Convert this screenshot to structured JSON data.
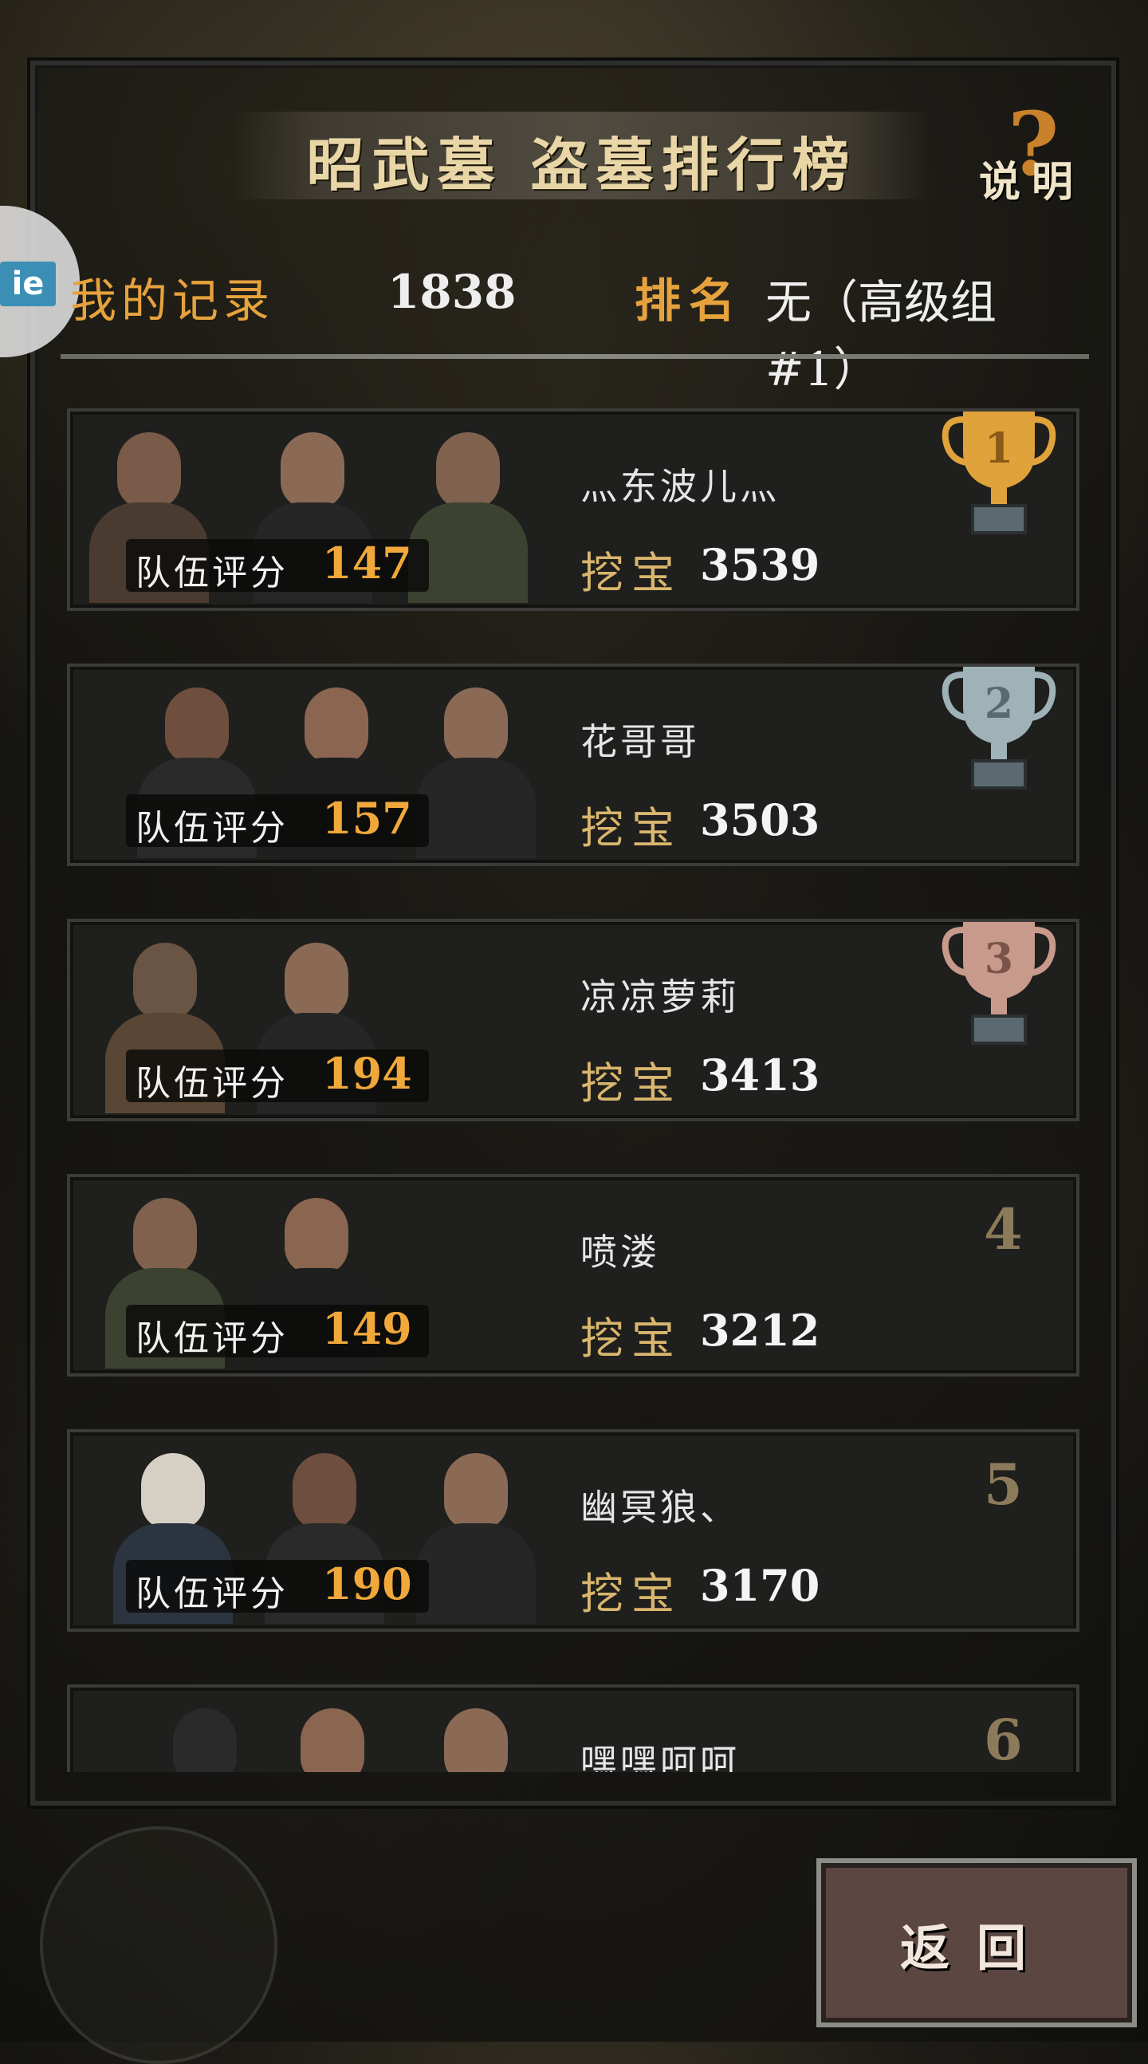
{
  "header": {
    "title": "昭武墓 盗墓排行榜",
    "help_label": "说明",
    "help_icon": "question-mark-icon"
  },
  "side_badge": {
    "label": "ie"
  },
  "record": {
    "label": "我的记录",
    "value": "1838",
    "rank_label": "排名",
    "rank_value": "无（高级组#1）"
  },
  "entries": [
    {
      "rank": "1",
      "name": "灬东波儿灬",
      "score_label": "队伍评分",
      "score": "147",
      "dig_label": "挖宝",
      "dig_value": "3539",
      "trophy": "gold-trophy-icon",
      "trophy_color": "#e0a23a"
    },
    {
      "rank": "2",
      "name": "花哥哥",
      "score_label": "队伍评分",
      "score": "157",
      "dig_label": "挖宝",
      "dig_value": "3503",
      "trophy": "silver-trophy-icon",
      "trophy_color": "#9fb2b8"
    },
    {
      "rank": "3",
      "name": "凉凉萝莉",
      "score_label": "队伍评分",
      "score": "194",
      "dig_label": "挖宝",
      "dig_value": "3413",
      "trophy": "bronze-trophy-icon",
      "trophy_color": "#c79a8c"
    },
    {
      "rank": "4",
      "name": "喷溇",
      "score_label": "队伍评分",
      "score": "149",
      "dig_label": "挖宝",
      "dig_value": "3212"
    },
    {
      "rank": "5",
      "name": "幽冥狼、",
      "score_label": "队伍评分",
      "score": "190",
      "dig_label": "挖宝",
      "dig_value": "3170"
    },
    {
      "rank": "6",
      "name": "嘿嘿呵呵",
      "score_label": "",
      "score": "",
      "dig_label": "",
      "dig_value": ""
    }
  ],
  "footer": {
    "back_label": "返回"
  }
}
